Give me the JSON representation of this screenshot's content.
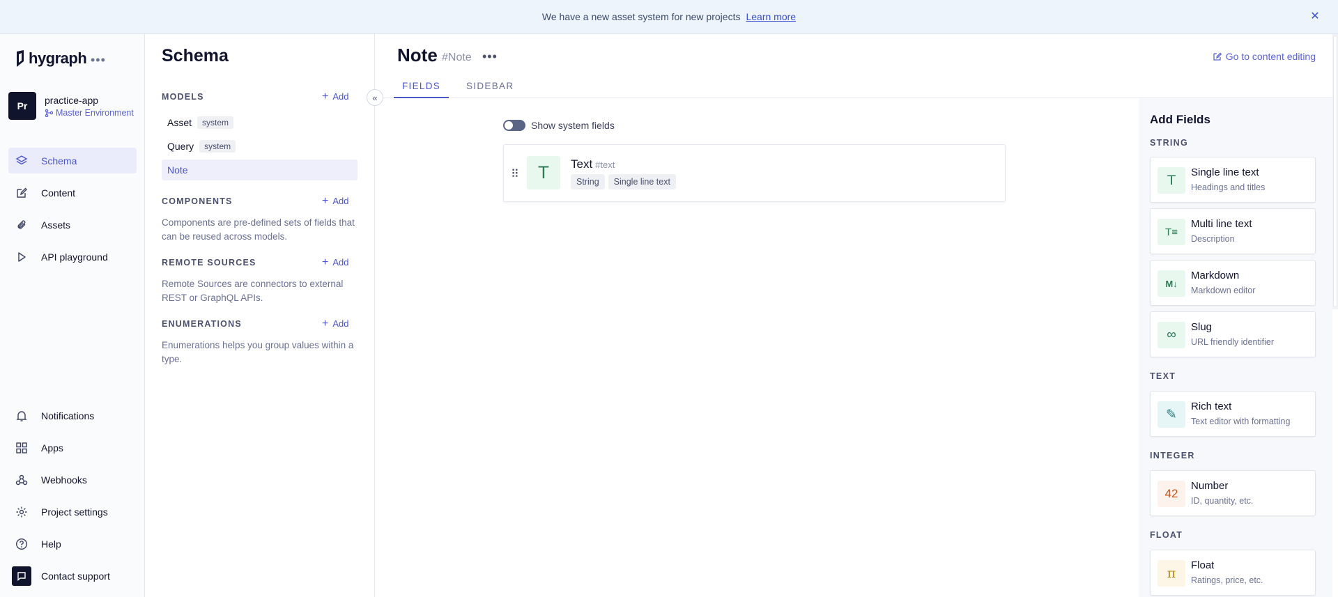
{
  "banner": {
    "message": "We have a new asset system for new projects",
    "link": "Learn more",
    "close_icon": "close-icon"
  },
  "brand": {
    "name": "hygraph"
  },
  "project": {
    "avatar": "Pr",
    "name": "practice-app",
    "environment": "Master Environment"
  },
  "nav": {
    "top": [
      {
        "label": "Schema",
        "icon": "layers-icon",
        "active": true
      },
      {
        "label": "Content",
        "icon": "edit-icon"
      },
      {
        "label": "Assets",
        "icon": "paperclip-icon"
      },
      {
        "label": "API playground",
        "icon": "play-icon"
      }
    ],
    "bottom": [
      {
        "label": "Notifications",
        "icon": "bell-icon"
      },
      {
        "label": "Apps",
        "icon": "grid-icon"
      },
      {
        "label": "Webhooks",
        "icon": "webhook-icon"
      },
      {
        "label": "Project settings",
        "icon": "gear-icon"
      },
      {
        "label": "Help",
        "icon": "help-icon"
      },
      {
        "label": "Contact support",
        "icon": "chat-icon"
      }
    ]
  },
  "schema": {
    "title": "Schema",
    "add_label": "Add",
    "models": {
      "title": "MODELS",
      "items": [
        {
          "label": "Asset",
          "tag": "system"
        },
        {
          "label": "Query",
          "tag": "system"
        },
        {
          "label": "Note",
          "active": true
        }
      ]
    },
    "components": {
      "title": "COMPONENTS",
      "desc": "Components are pre-defined sets of fields that can be reused across models."
    },
    "remote_sources": {
      "title": "REMOTE SOURCES",
      "desc": "Remote Sources are connectors to external REST or GraphQL APIs."
    },
    "enumerations": {
      "title": "ENUMERATIONS",
      "desc": "Enumerations helps you group values within a type."
    }
  },
  "model": {
    "title": "Note",
    "api_id": "#Note",
    "goto": "Go to content editing",
    "tabs": [
      "FIELDS",
      "SIDEBAR"
    ],
    "active_tab": "FIELDS",
    "show_system_fields": "Show system fields",
    "show_system_fields_on": false,
    "fields": [
      {
        "name": "Text",
        "api_id": "#text",
        "icon": "T",
        "tags": [
          "String",
          "Single line text"
        ]
      }
    ]
  },
  "add_fields": {
    "title": "Add Fields",
    "categories": [
      {
        "name": "STRING",
        "items": [
          {
            "name": "Single line text",
            "desc": "Headings and titles",
            "glyph": "T",
            "icon": "text-icon"
          },
          {
            "name": "Multi line text",
            "desc": "Description",
            "glyph": "T≡",
            "icon": "multiline-icon"
          },
          {
            "name": "Markdown",
            "desc": "Markdown editor",
            "glyph": "M↓",
            "icon": "markdown-icon"
          },
          {
            "name": "Slug",
            "desc": "URL friendly identifier",
            "glyph": "∞",
            "icon": "link-icon"
          }
        ]
      },
      {
        "name": "TEXT",
        "items": [
          {
            "name": "Rich text",
            "desc": "Text editor with formatting",
            "glyph": "✎",
            "icon": "rich-text-icon"
          }
        ]
      },
      {
        "name": "INTEGER",
        "items": [
          {
            "name": "Number",
            "desc": "ID, quantity, etc.",
            "glyph": "42",
            "icon": "number-icon"
          }
        ]
      },
      {
        "name": "FLOAT",
        "items": [
          {
            "name": "Float",
            "desc": "Ratings, price, etc.",
            "glyph": "π",
            "icon": "pi-icon"
          }
        ]
      }
    ]
  },
  "colors": {
    "accent": "#4b55c8",
    "banner_bg": "#eef4fb",
    "string_icon_bg": "#e9f8ef",
    "text_icon_bg": "#e6f6f6",
    "number_icon_bg": "#fdf3ec",
    "float_icon_bg": "#fdf6e6"
  }
}
